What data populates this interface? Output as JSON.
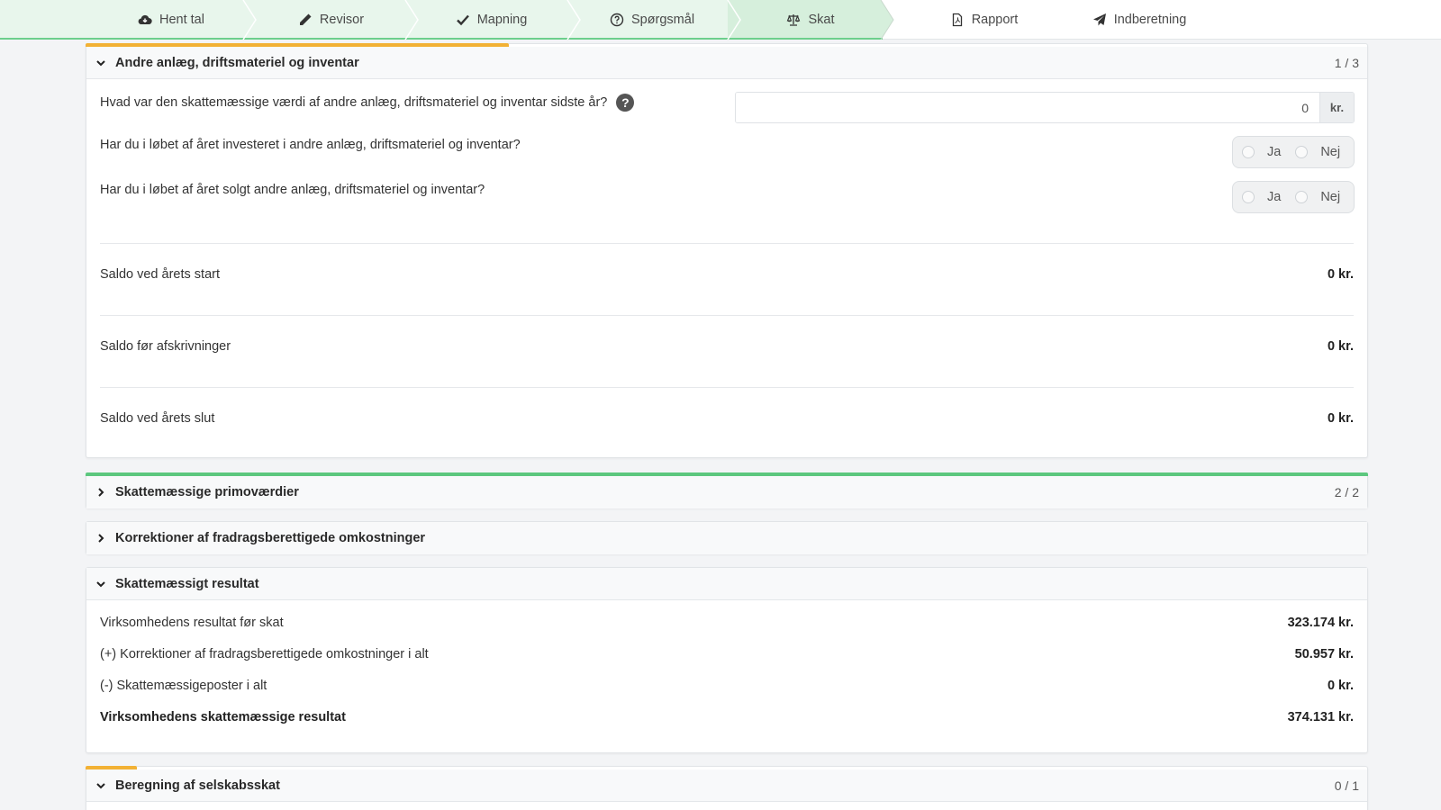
{
  "nav": {
    "steps": [
      {
        "label": "Hent tal",
        "icon": "cloud-download-icon"
      },
      {
        "label": "Revisor",
        "icon": "pencil-icon"
      },
      {
        "label": "Mapning",
        "icon": "check-icon"
      },
      {
        "label": "Spørgsmål",
        "icon": "question-circle-icon"
      },
      {
        "label": "Skat",
        "icon": "balance-scale-icon"
      },
      {
        "label": "Rapport",
        "icon": "file-pdf-icon"
      },
      {
        "label": "Indberetning",
        "icon": "paper-plane-icon"
      }
    ],
    "colors": {
      "done_bg": "#e8f6ec",
      "done_border": "#6ccf8c",
      "active_bg": "#d6efdc"
    }
  },
  "panels": {
    "anlaeg": {
      "title": "Andre anlæg, driftsmateriel og inventar",
      "count": "1 / 3",
      "progress": 0.33,
      "progress_color": "#f2b134",
      "q1": {
        "text": "Hvad var den skattemæssige værdi af andre anlæg, driftsmateriel og inventar sidste år?",
        "help": "?",
        "value": "0",
        "suffix": "kr."
      },
      "q2": {
        "text": "Har du i løbet af året investeret i andre anlæg, driftsmateriel og inventar?",
        "yes": "Ja",
        "no": "Nej"
      },
      "q3": {
        "text": "Har du i løbet af året solgt andre anlæg, driftsmateriel og inventar?",
        "yes": "Ja",
        "no": "Nej"
      },
      "summary": [
        {
          "label": "Saldo ved årets start",
          "value": "0 kr."
        },
        {
          "label": "Saldo før afskrivninger",
          "value": "0 kr."
        },
        {
          "label": "Saldo ved årets slut",
          "value": "0 kr."
        }
      ]
    },
    "primo": {
      "title": "Skattemæssige primoværdier",
      "count": "2 / 2",
      "progress": 1.0,
      "progress_color": "#5cc77e"
    },
    "korrektioner": {
      "title": "Korrektioner af fradragsberettigede omkostninger"
    },
    "resultat": {
      "title": "Skattemæssigt resultat",
      "rows": [
        {
          "label": "Virksomhedens resultat før skat",
          "value": "323.174 kr."
        },
        {
          "label": "(+) Korrektioner af fradragsberettigede omkostninger i alt",
          "value": "50.957 kr."
        },
        {
          "label": "(-) Skattemæssigeposter i alt",
          "value": "0 kr."
        },
        {
          "label": "Virksomhedens skattemæssige resultat",
          "value": "374.131 kr."
        }
      ]
    },
    "selskabsskat": {
      "title": "Beregning af selskabsskat",
      "count": "0 / 1",
      "progress": 0.04,
      "progress_color": "#f2b134"
    }
  }
}
